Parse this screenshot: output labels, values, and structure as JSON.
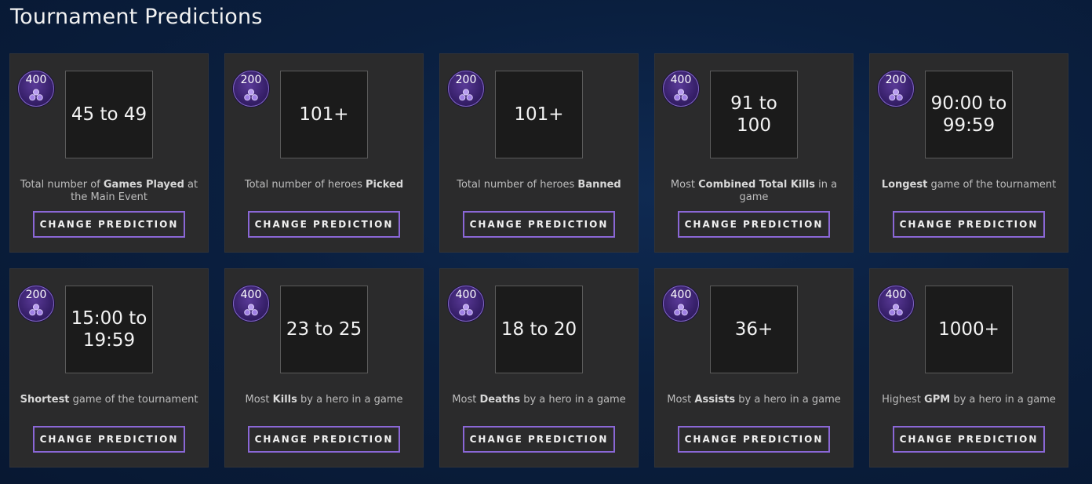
{
  "header": {
    "title": "Tournament Predictions"
  },
  "colors": {
    "card_bg": "#2b2b2c",
    "badge_purple": "#4a2d87",
    "button_border": "#8a67d6",
    "page_bg": "#0a1f3f"
  },
  "cards": [
    {
      "points": "400",
      "answer": "45 to 49",
      "desc_pre": "Total number of ",
      "desc_bold": "Games Played",
      "desc_post": " at the Main Event",
      "button": "CHANGE PREDICTION"
    },
    {
      "points": "200",
      "answer": "101+",
      "desc_pre": "Total number of heroes ",
      "desc_bold": "Picked",
      "desc_post": "",
      "button": "CHANGE PREDICTION"
    },
    {
      "points": "200",
      "answer": "101+",
      "desc_pre": "Total number of heroes ",
      "desc_bold": "Banned",
      "desc_post": "",
      "button": "CHANGE PREDICTION"
    },
    {
      "points": "400",
      "answer": "91 to 100",
      "desc_pre": "Most ",
      "desc_bold": "Combined Total Kills",
      "desc_post": " in a game",
      "button": "CHANGE PREDICTION"
    },
    {
      "points": "200",
      "answer": "90:00 to 99:59",
      "desc_pre": "",
      "desc_bold": "Longest",
      "desc_post": " game of the tournament",
      "button": "CHANGE PREDICTION"
    },
    {
      "points": "200",
      "answer": "15:00 to 19:59",
      "desc_pre": "",
      "desc_bold": "Shortest",
      "desc_post": " game of the tournament",
      "button": "CHANGE PREDICTION"
    },
    {
      "points": "400",
      "answer": "23 to 25",
      "desc_pre": "Most ",
      "desc_bold": "Kills",
      "desc_post": " by a hero in a game",
      "button": "CHANGE PREDICTION"
    },
    {
      "points": "400",
      "answer": "18 to 20",
      "desc_pre": "Most ",
      "desc_bold": "Deaths",
      "desc_post": " by a hero in a game",
      "button": "CHANGE PREDICTION"
    },
    {
      "points": "400",
      "answer": "36+",
      "desc_pre": "Most ",
      "desc_bold": "Assists",
      "desc_post": " by a hero in a game",
      "button": "CHANGE PREDICTION"
    },
    {
      "points": "400",
      "answer": "1000+",
      "desc_pre": "Highest ",
      "desc_bold": "GPM",
      "desc_post": " by a hero in a game",
      "button": "CHANGE PREDICTION"
    }
  ]
}
